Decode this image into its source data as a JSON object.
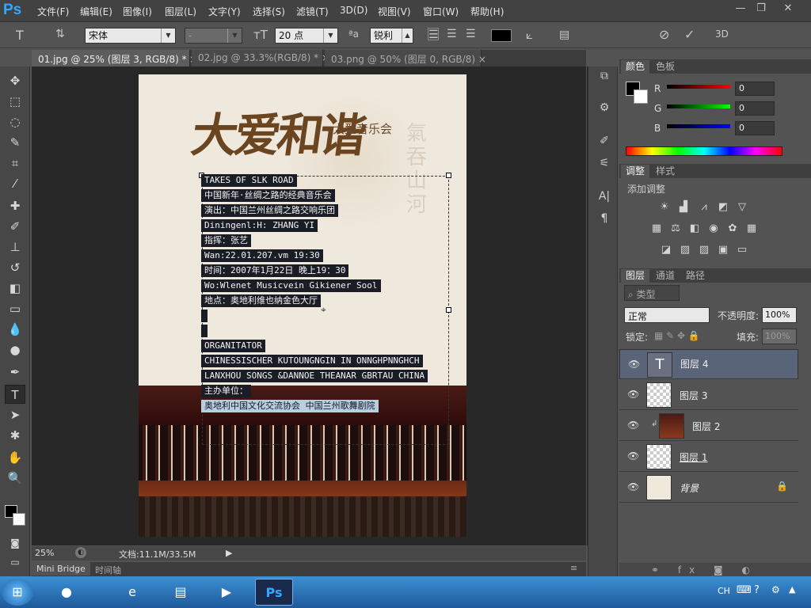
{
  "app": {
    "logo": "Ps"
  },
  "menu": [
    "文件(F)",
    "编辑(E)",
    "图像(I)",
    "图层(L)",
    "文字(Y)",
    "选择(S)",
    "滤镜(T)",
    "3D(D)",
    "视图(V)",
    "窗口(W)",
    "帮助(H)"
  ],
  "options": {
    "font_family": "宋体",
    "font_style": "-",
    "font_size": "20 点",
    "antialias": "锐利",
    "text_color": "#000000",
    "three_d": "3D"
  },
  "tabs": [
    "01.jpg @ 25% (图层 3, RGB/8) *",
    "02.jpg @ 33.3%(RGB/8) *",
    "03.png @ 50% (图层 0, RGB/8)"
  ],
  "document": {
    "title_art": "大爱和谐",
    "subtitle": "大型音乐会",
    "lines": [
      "TAKES  OF  SLK  ROAD",
      "中国新年·丝绸之路的经典音乐会",
      "演出：中国兰州丝绸之路交响乐团",
      "Diningenl:H: ZHANG YI",
      "指挥：张艺",
      "Wan:22.01.207.vm 19:30",
      "时间：2007年1月22日 晚上19：30",
      "Wo:Wlenet Musicvein Gikiener Sool",
      "地点：奥地利维也纳金色大厅",
      "",
      "",
      "ORGANITATOR",
      "CHINESSISCHER KUTOUNGNGIN IN ONNGHPNNGHCH",
      "LANXHOU SONGS &DANNOE THEANAR GBRTAU CHINA",
      "主办单位：",
      "奥地利中国文化交流协会  中国兰州歌舞剧院"
    ]
  },
  "status": {
    "zoom": "25%",
    "doc": "文档:11.1M/33.5M"
  },
  "bottom_tabs": [
    "Mini Bridge",
    "时间轴"
  ],
  "color_panel": {
    "tabs": [
      "颜色",
      "色板"
    ],
    "channels": [
      {
        "label": "R",
        "value": "0"
      },
      {
        "label": "G",
        "value": "0"
      },
      {
        "label": "B",
        "value": "0"
      }
    ]
  },
  "adjust_panel": {
    "tabs": [
      "调整",
      "样式"
    ],
    "heading": "添加调整"
  },
  "layers_panel": {
    "tabs": [
      "图层",
      "通道",
      "路径"
    ],
    "filter_label": "类型",
    "blend_mode": "正常",
    "opacity_label": "不透明度:",
    "opacity": "100%",
    "lock_label": "锁定:",
    "fill_label": "填充:",
    "fill": "100%",
    "layers": [
      {
        "name": "图层 4",
        "selected": true,
        "type": "text"
      },
      {
        "name": "图层 3",
        "selected": false,
        "type": "pixel"
      },
      {
        "name": "图层 2",
        "selected": false,
        "type": "photo"
      },
      {
        "name": "图层 1",
        "selected": false,
        "type": "pixel"
      },
      {
        "name": "背景",
        "selected": false,
        "type": "background"
      }
    ]
  },
  "taskbar": {
    "lang": "CH",
    "active_app": "Ps"
  }
}
